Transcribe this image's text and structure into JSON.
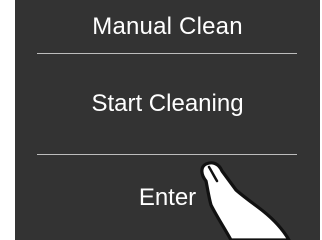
{
  "screen": {
    "title": "Manual Clean",
    "action_label": "Start Cleaning",
    "enter_label": "Enter"
  },
  "colors": {
    "screen_background": "#333333",
    "text": "#ffffff",
    "divider": "#bdbdbd",
    "hand_fill": "#ffffff",
    "hand_outline": "#111111"
  },
  "icons": {
    "gesture": "tap-hand-icon"
  }
}
